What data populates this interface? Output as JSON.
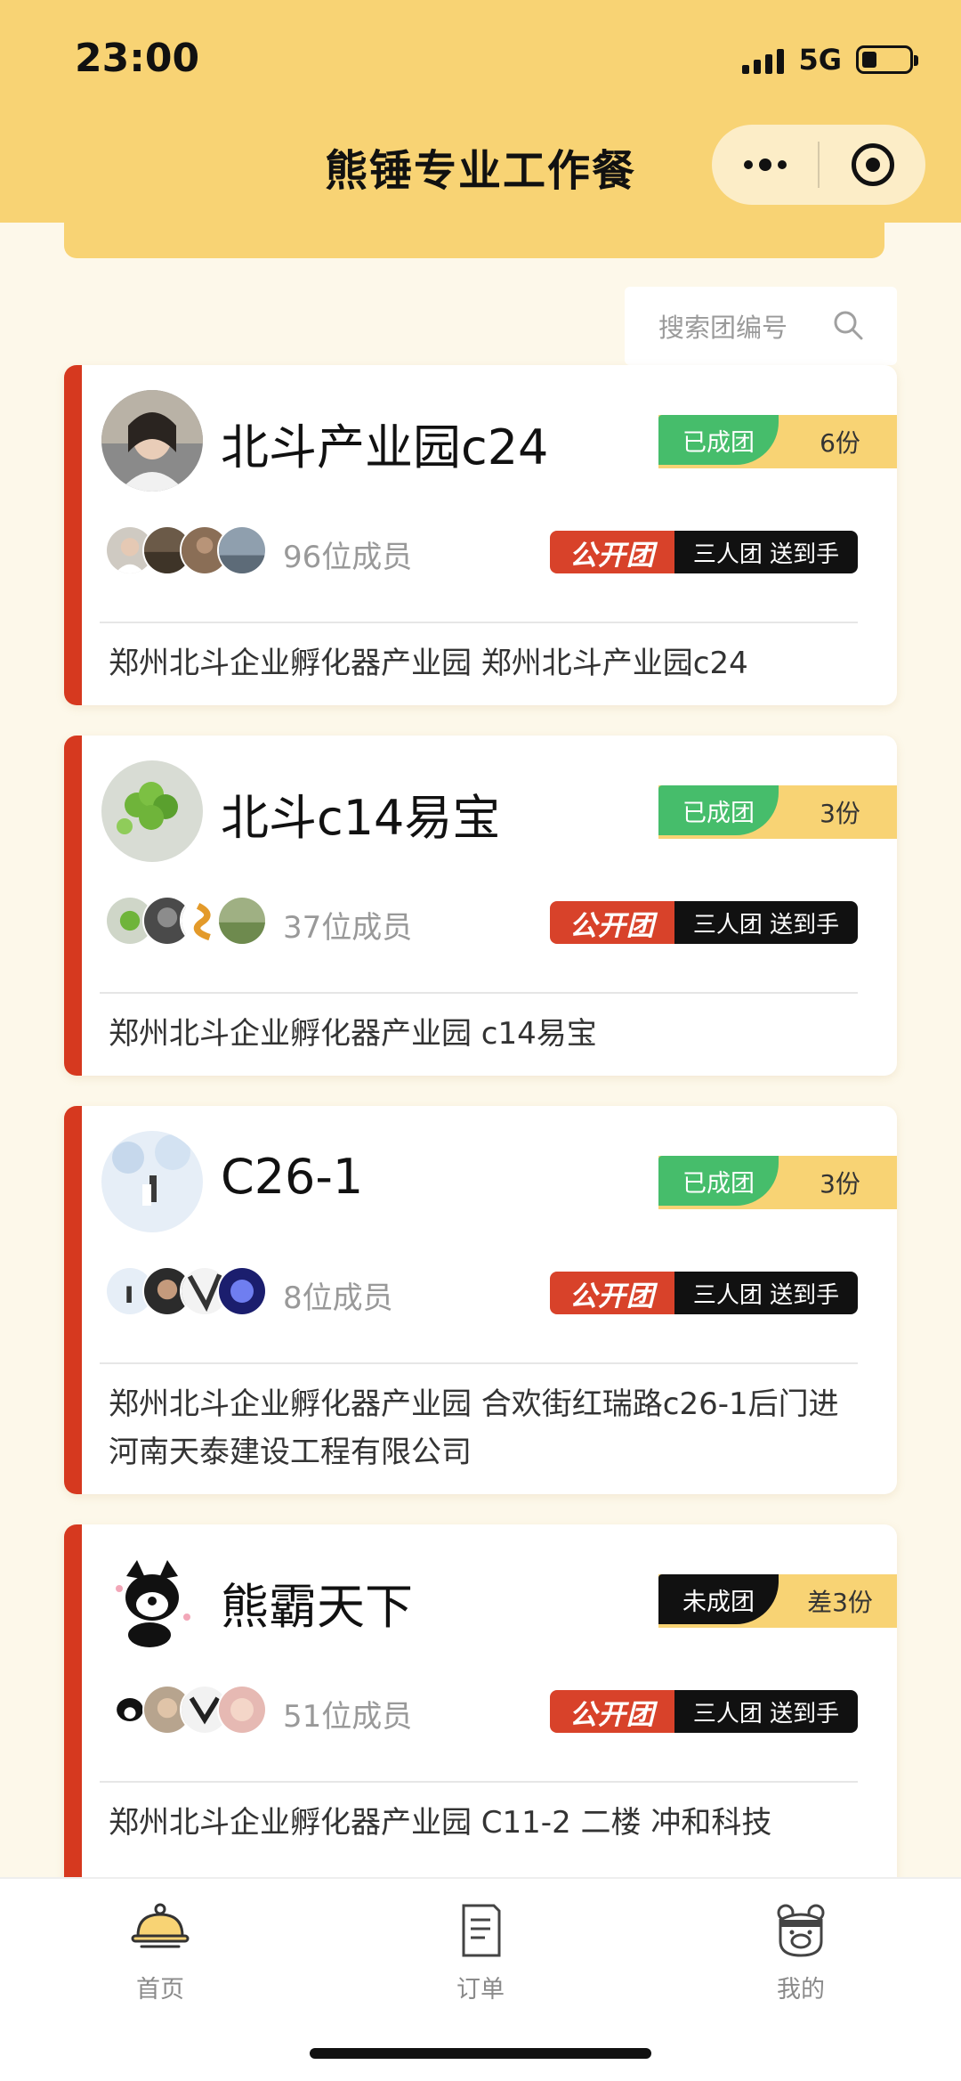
{
  "status_bar": {
    "time": "23:00",
    "network": "5G"
  },
  "nav": {
    "title": "熊锤专业工作餐"
  },
  "search": {
    "placeholder": "搜索团编号"
  },
  "groups": [
    {
      "name": "北斗产业园c24",
      "status": "已成团",
      "portions": "6份",
      "members": "96位成员",
      "badge_public": "公开团",
      "badge_type": "三人团 送到手",
      "address": "郑州北斗企业孵化器产业园 郑州北斗产业园c24"
    },
    {
      "name": "北斗c14易宝",
      "status": "已成团",
      "portions": "3份",
      "members": "37位成员",
      "badge_public": "公开团",
      "badge_type": "三人团 送到手",
      "address": "郑州北斗企业孵化器产业园 c14易宝"
    },
    {
      "name": "C26-1",
      "status": "已成团",
      "portions": "3份",
      "members": "8位成员",
      "badge_public": "公开团",
      "badge_type": "三人团 送到手",
      "address": "郑州北斗企业孵化器产业园 合欢街红瑞路c26-1后门进河南天泰建设工程有限公司"
    },
    {
      "name": "熊霸天下",
      "status": "未成团",
      "portions": "差3份",
      "members": "51位成员",
      "badge_public": "公开团",
      "badge_type": "三人团 送到手",
      "address": "郑州北斗企业孵化器产业园 C11-2 二楼 冲和科技"
    }
  ],
  "tabs": [
    {
      "label": "首页",
      "icon": "cloche-icon"
    },
    {
      "label": "订单",
      "icon": "order-icon"
    },
    {
      "label": "我的",
      "icon": "bear-icon"
    }
  ],
  "colors": {
    "brand_yellow": "#f8d374",
    "accent_red": "#d6391f",
    "formed_green": "#46bd6b",
    "pending_black": "#111111"
  }
}
